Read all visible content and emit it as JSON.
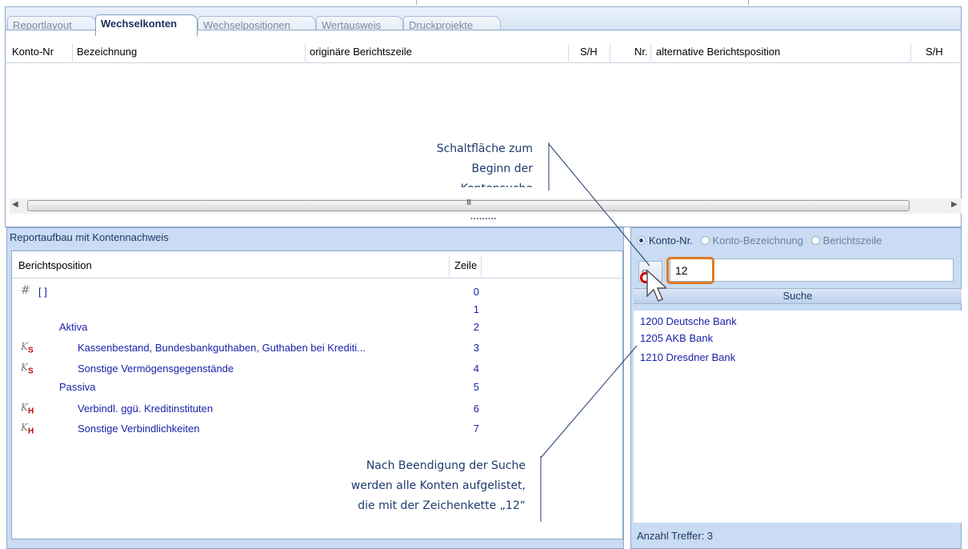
{
  "tabs": [
    "Reportlayout",
    "Wechselkonten",
    "Wechselpositionen",
    "Wertausweis",
    "Druckprojekte"
  ],
  "active_tab": "Wechselkonten",
  "grid": {
    "columns": [
      "Konto-Nr",
      "Bezeichnung",
      "originäre Berichtszeile",
      "S/H",
      "Nr.",
      "alternative Berichtsposition",
      "S/H"
    ],
    "scroll_grip": "III"
  },
  "left_panel": {
    "title": "Reportaufbau mit Kontennachweis",
    "col_position": "Berichtsposition",
    "col_zeile": "Zeile",
    "rows": [
      {
        "icon": "#",
        "label": "[ ]",
        "line": "0"
      },
      {
        "icon": "",
        "label": "",
        "line": "1"
      },
      {
        "icon": "",
        "label": "Aktiva",
        "line": "2"
      },
      {
        "icon": "K",
        "sub": "S",
        "label": "Kassenbestand, Bundesbankguthaben, Guthaben bei Krediti...",
        "line": "3"
      },
      {
        "icon": "K",
        "sub": "S",
        "label": "Sonstige Vermögensgegenstände",
        "line": "4"
      },
      {
        "icon": "",
        "label": "Passiva",
        "line": "5"
      },
      {
        "icon": "K",
        "sub": "H",
        "label": "Verbindl. ggü. Kreditinstituten",
        "line": "6"
      },
      {
        "icon": "K",
        "sub": "H",
        "label": "Sonstige Verbindlichkeiten",
        "line": "7"
      }
    ]
  },
  "search": {
    "options": [
      "Konto-Nr.",
      "Konto-Bezeichnung",
      "Berichtszeile"
    ],
    "selected": "Konto-Nr.",
    "value": "12",
    "button_label": "Suche",
    "results": [
      "1200  Deutsche Bank",
      "1205  AKB Bank",
      "1210  Dresdner Bank"
    ],
    "hits": "Anzahl Treffer: 3"
  },
  "annotations": {
    "note1": [
      "Schaltfläche zum",
      "Beginn der",
      "Kontensuche"
    ],
    "note2": [
      "Nach Beendigung der Suche",
      "werden alle Konten aufgelistet,",
      "die mit der Zeichenkette „12“"
    ]
  },
  "colors": {
    "accent": "#1f3864",
    "link_text": "#1a23a8",
    "panel_bg": "#c9dcf3",
    "highlight": "#e07b22"
  }
}
